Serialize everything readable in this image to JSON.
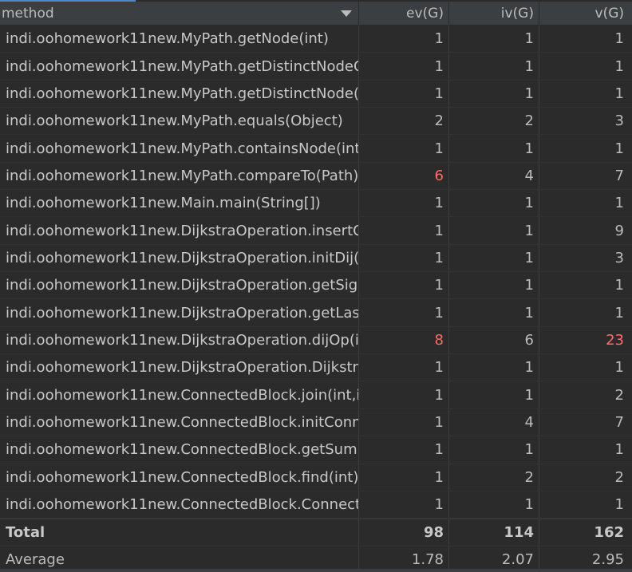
{
  "header": {
    "method": "method",
    "ev": "ev(G)",
    "iv": "iv(G)",
    "v": "v(G)"
  },
  "rows": [
    {
      "method": "indi.oohomework11new.MyPath.getNode(int)",
      "ev": "1",
      "iv": "1",
      "v": "1"
    },
    {
      "method": "indi.oohomework11new.MyPath.getDistinctNodeCo",
      "ev": "1",
      "iv": "1",
      "v": "1"
    },
    {
      "method": "indi.oohomework11new.MyPath.getDistinctNode()",
      "ev": "1",
      "iv": "1",
      "v": "1"
    },
    {
      "method": "indi.oohomework11new.MyPath.equals(Object)",
      "ev": "2",
      "iv": "2",
      "v": "3"
    },
    {
      "method": "indi.oohomework11new.MyPath.containsNode(int)",
      "ev": "1",
      "iv": "1",
      "v": "1"
    },
    {
      "method": "indi.oohomework11new.MyPath.compareTo(Path)",
      "ev": "6",
      "iv": "4",
      "v": "7"
    },
    {
      "method": "indi.oohomework11new.Main.main(String[])",
      "ev": "1",
      "iv": "1",
      "v": "1"
    },
    {
      "method": "indi.oohomework11new.DijkstraOperation.insertOp",
      "ev": "1",
      "iv": "1",
      "v": "9"
    },
    {
      "method": "indi.oohomework11new.DijkstraOperation.initDij(in",
      "ev": "1",
      "iv": "1",
      "v": "3"
    },
    {
      "method": "indi.oohomework11new.DijkstraOperation.getSign(",
      "ev": "1",
      "iv": "1",
      "v": "1"
    },
    {
      "method": "indi.oohomework11new.DijkstraOperation.getLastV",
      "ev": "1",
      "iv": "1",
      "v": "1"
    },
    {
      "method": "indi.oohomework11new.DijkstraOperation.dijOp(in",
      "ev": "8",
      "iv": "6",
      "v": "23"
    },
    {
      "method": "indi.oohomework11new.DijkstraOperation.DijkstraO",
      "ev": "1",
      "iv": "1",
      "v": "1"
    },
    {
      "method": "indi.oohomework11new.ConnectedBlock.join(int,int",
      "ev": "1",
      "iv": "1",
      "v": "2"
    },
    {
      "method": "indi.oohomework11new.ConnectedBlock.initConnec",
      "ev": "1",
      "iv": "4",
      "v": "7"
    },
    {
      "method": "indi.oohomework11new.ConnectedBlock.getSum()",
      "ev": "1",
      "iv": "1",
      "v": "1"
    },
    {
      "method": "indi.oohomework11new.ConnectedBlock.find(int)",
      "ev": "1",
      "iv": "2",
      "v": "2"
    },
    {
      "method": "indi.oohomework11new.ConnectedBlock.Connecte",
      "ev": "1",
      "iv": "1",
      "v": "1"
    }
  ],
  "total": {
    "label": "Total",
    "ev": "98",
    "iv": "114",
    "v": "162"
  },
  "average": {
    "label": "Average",
    "ev": "1.78",
    "iv": "2.07",
    "v": "2.95"
  },
  "colors": {
    "background": "#2b2b2b",
    "header_background": "#3c3f41",
    "text": "#bbbbbb",
    "highlight": "#ff6b68",
    "tab_accent": "#4a88c7"
  },
  "icons": {
    "sort": "sort-descending-icon"
  }
}
